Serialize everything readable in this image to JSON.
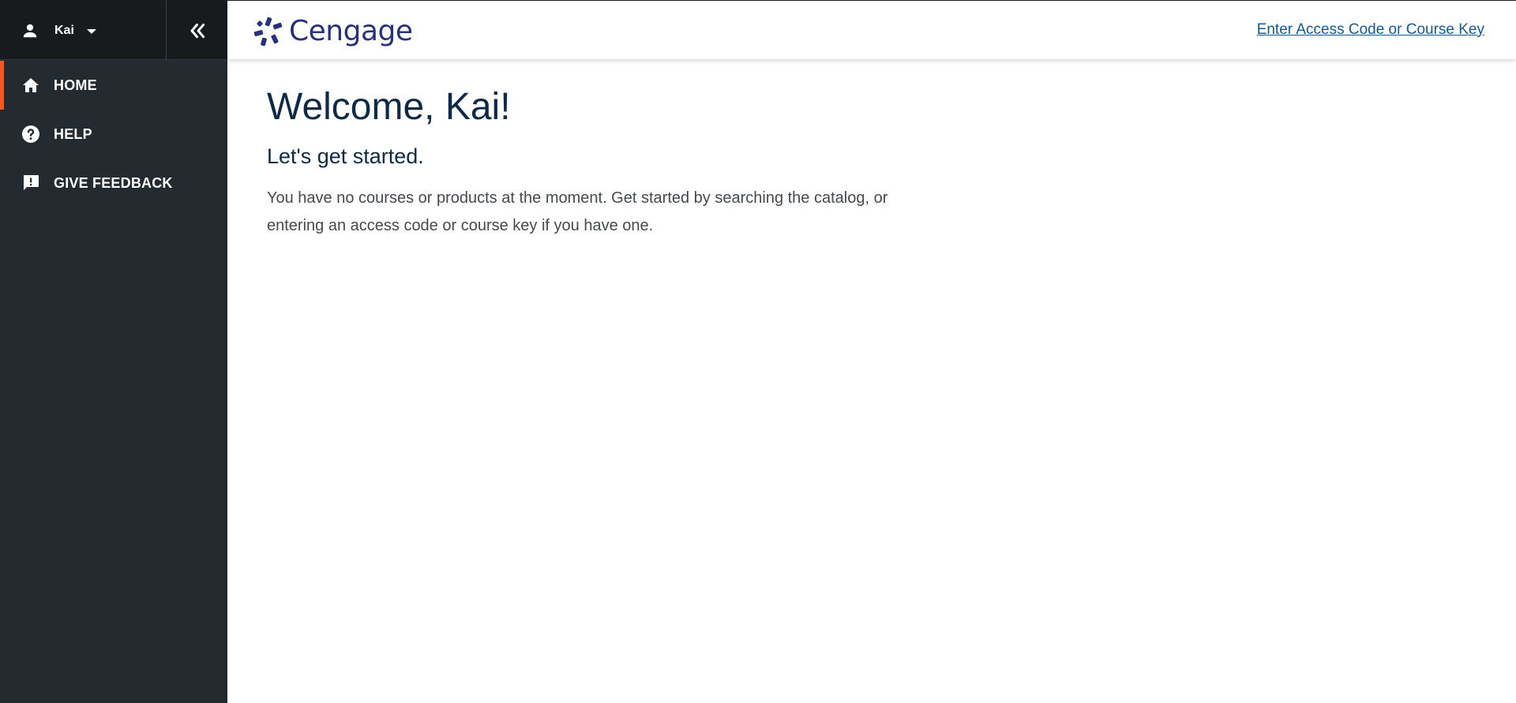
{
  "sidebar": {
    "user": {
      "name": "Kai",
      "icon": "person-icon"
    },
    "collapse_icon": "double-chevron-left-icon",
    "items": [
      {
        "label": "HOME",
        "icon": "home-icon",
        "active": true
      },
      {
        "label": "HELP",
        "icon": "help-icon",
        "active": false
      },
      {
        "label": "GIVE FEEDBACK",
        "icon": "feedback-icon",
        "active": false
      }
    ]
  },
  "header": {
    "brand": "Cengage",
    "access_link": "Enter Access Code or Course Key"
  },
  "main": {
    "welcome": "Welcome, Kai!",
    "subheading": "Let's get started.",
    "intro": "You have no courses or products at the moment. Get started by searching the catalog, or entering an access code or course key if you have one."
  },
  "colors": {
    "sidebar_bg": "#232a30",
    "sidebar_top_bg": "#181b1e",
    "active_accent": "#f25822",
    "brand": "#28327a",
    "link": "#125b96",
    "heading": "#0e2a47"
  }
}
